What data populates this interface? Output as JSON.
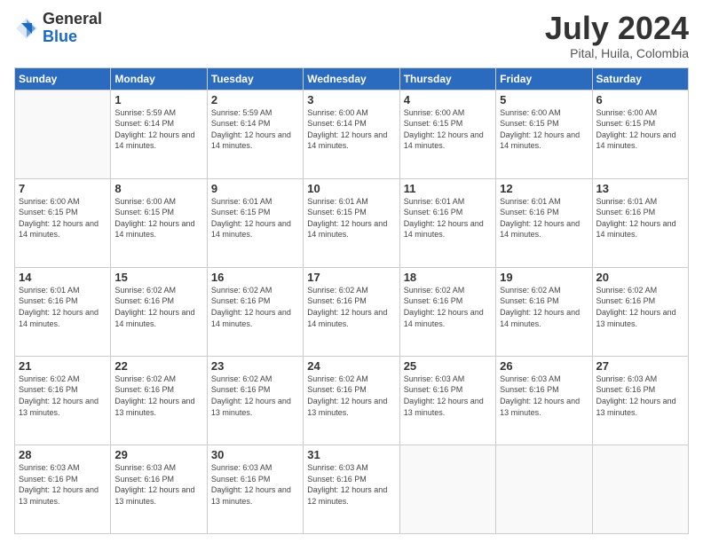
{
  "header": {
    "logo_general": "General",
    "logo_blue": "Blue",
    "month_year": "July 2024",
    "location": "Pital, Huila, Colombia"
  },
  "weekdays": [
    "Sunday",
    "Monday",
    "Tuesday",
    "Wednesday",
    "Thursday",
    "Friday",
    "Saturday"
  ],
  "weeks": [
    [
      {
        "day": "",
        "sunrise": "",
        "sunset": "",
        "daylight": ""
      },
      {
        "day": "1",
        "sunrise": "Sunrise: 5:59 AM",
        "sunset": "Sunset: 6:14 PM",
        "daylight": "Daylight: 12 hours and 14 minutes."
      },
      {
        "day": "2",
        "sunrise": "Sunrise: 5:59 AM",
        "sunset": "Sunset: 6:14 PM",
        "daylight": "Daylight: 12 hours and 14 minutes."
      },
      {
        "day": "3",
        "sunrise": "Sunrise: 6:00 AM",
        "sunset": "Sunset: 6:14 PM",
        "daylight": "Daylight: 12 hours and 14 minutes."
      },
      {
        "day": "4",
        "sunrise": "Sunrise: 6:00 AM",
        "sunset": "Sunset: 6:15 PM",
        "daylight": "Daylight: 12 hours and 14 minutes."
      },
      {
        "day": "5",
        "sunrise": "Sunrise: 6:00 AM",
        "sunset": "Sunset: 6:15 PM",
        "daylight": "Daylight: 12 hours and 14 minutes."
      },
      {
        "day": "6",
        "sunrise": "Sunrise: 6:00 AM",
        "sunset": "Sunset: 6:15 PM",
        "daylight": "Daylight: 12 hours and 14 minutes."
      }
    ],
    [
      {
        "day": "7",
        "sunrise": "Sunrise: 6:00 AM",
        "sunset": "Sunset: 6:15 PM",
        "daylight": "Daylight: 12 hours and 14 minutes."
      },
      {
        "day": "8",
        "sunrise": "Sunrise: 6:00 AM",
        "sunset": "Sunset: 6:15 PM",
        "daylight": "Daylight: 12 hours and 14 minutes."
      },
      {
        "day": "9",
        "sunrise": "Sunrise: 6:01 AM",
        "sunset": "Sunset: 6:15 PM",
        "daylight": "Daylight: 12 hours and 14 minutes."
      },
      {
        "day": "10",
        "sunrise": "Sunrise: 6:01 AM",
        "sunset": "Sunset: 6:15 PM",
        "daylight": "Daylight: 12 hours and 14 minutes."
      },
      {
        "day": "11",
        "sunrise": "Sunrise: 6:01 AM",
        "sunset": "Sunset: 6:16 PM",
        "daylight": "Daylight: 12 hours and 14 minutes."
      },
      {
        "day": "12",
        "sunrise": "Sunrise: 6:01 AM",
        "sunset": "Sunset: 6:16 PM",
        "daylight": "Daylight: 12 hours and 14 minutes."
      },
      {
        "day": "13",
        "sunrise": "Sunrise: 6:01 AM",
        "sunset": "Sunset: 6:16 PM",
        "daylight": "Daylight: 12 hours and 14 minutes."
      }
    ],
    [
      {
        "day": "14",
        "sunrise": "Sunrise: 6:01 AM",
        "sunset": "Sunset: 6:16 PM",
        "daylight": "Daylight: 12 hours and 14 minutes."
      },
      {
        "day": "15",
        "sunrise": "Sunrise: 6:02 AM",
        "sunset": "Sunset: 6:16 PM",
        "daylight": "Daylight: 12 hours and 14 minutes."
      },
      {
        "day": "16",
        "sunrise": "Sunrise: 6:02 AM",
        "sunset": "Sunset: 6:16 PM",
        "daylight": "Daylight: 12 hours and 14 minutes."
      },
      {
        "day": "17",
        "sunrise": "Sunrise: 6:02 AM",
        "sunset": "Sunset: 6:16 PM",
        "daylight": "Daylight: 12 hours and 14 minutes."
      },
      {
        "day": "18",
        "sunrise": "Sunrise: 6:02 AM",
        "sunset": "Sunset: 6:16 PM",
        "daylight": "Daylight: 12 hours and 14 minutes."
      },
      {
        "day": "19",
        "sunrise": "Sunrise: 6:02 AM",
        "sunset": "Sunset: 6:16 PM",
        "daylight": "Daylight: 12 hours and 14 minutes."
      },
      {
        "day": "20",
        "sunrise": "Sunrise: 6:02 AM",
        "sunset": "Sunset: 6:16 PM",
        "daylight": "Daylight: 12 hours and 13 minutes."
      }
    ],
    [
      {
        "day": "21",
        "sunrise": "Sunrise: 6:02 AM",
        "sunset": "Sunset: 6:16 PM",
        "daylight": "Daylight: 12 hours and 13 minutes."
      },
      {
        "day": "22",
        "sunrise": "Sunrise: 6:02 AM",
        "sunset": "Sunset: 6:16 PM",
        "daylight": "Daylight: 12 hours and 13 minutes."
      },
      {
        "day": "23",
        "sunrise": "Sunrise: 6:02 AM",
        "sunset": "Sunset: 6:16 PM",
        "daylight": "Daylight: 12 hours and 13 minutes."
      },
      {
        "day": "24",
        "sunrise": "Sunrise: 6:02 AM",
        "sunset": "Sunset: 6:16 PM",
        "daylight": "Daylight: 12 hours and 13 minutes."
      },
      {
        "day": "25",
        "sunrise": "Sunrise: 6:03 AM",
        "sunset": "Sunset: 6:16 PM",
        "daylight": "Daylight: 12 hours and 13 minutes."
      },
      {
        "day": "26",
        "sunrise": "Sunrise: 6:03 AM",
        "sunset": "Sunset: 6:16 PM",
        "daylight": "Daylight: 12 hours and 13 minutes."
      },
      {
        "day": "27",
        "sunrise": "Sunrise: 6:03 AM",
        "sunset": "Sunset: 6:16 PM",
        "daylight": "Daylight: 12 hours and 13 minutes."
      }
    ],
    [
      {
        "day": "28",
        "sunrise": "Sunrise: 6:03 AM",
        "sunset": "Sunset: 6:16 PM",
        "daylight": "Daylight: 12 hours and 13 minutes."
      },
      {
        "day": "29",
        "sunrise": "Sunrise: 6:03 AM",
        "sunset": "Sunset: 6:16 PM",
        "daylight": "Daylight: 12 hours and 13 minutes."
      },
      {
        "day": "30",
        "sunrise": "Sunrise: 6:03 AM",
        "sunset": "Sunset: 6:16 PM",
        "daylight": "Daylight: 12 hours and 13 minutes."
      },
      {
        "day": "31",
        "sunrise": "Sunrise: 6:03 AM",
        "sunset": "Sunset: 6:16 PM",
        "daylight": "Daylight: 12 hours and 12 minutes."
      },
      {
        "day": "",
        "sunrise": "",
        "sunset": "",
        "daylight": ""
      },
      {
        "day": "",
        "sunrise": "",
        "sunset": "",
        "daylight": ""
      },
      {
        "day": "",
        "sunrise": "",
        "sunset": "",
        "daylight": ""
      }
    ]
  ]
}
